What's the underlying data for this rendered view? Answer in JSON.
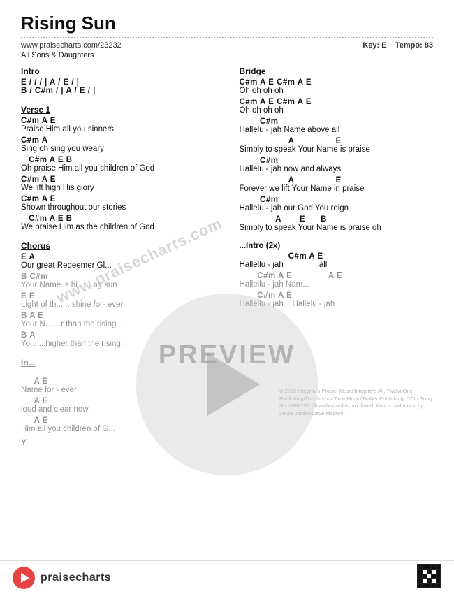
{
  "page": {
    "title": "Rising Sun",
    "url": "www.praisecharts.com/23232",
    "artist": "All Sons & Daughters",
    "key": "Key: E",
    "tempo": "Tempo: 83",
    "watermark_url": "www.praisecharts.com",
    "preview_label": "PREVIEW"
  },
  "sections": {
    "intro": {
      "title": "Intro",
      "lines": [
        {
          "type": "chord",
          "text": "E  /  /  /  |  A  /  E  /  |"
        },
        {
          "type": "chord",
          "text": "B  /  C#m  /  |  A  /  E  /  |"
        }
      ]
    },
    "verse1": {
      "title": "Verse 1",
      "groups": [
        {
          "chord": "C#m              A         E",
          "lyric": "Praise Him all you sinners"
        },
        {
          "chord": "C#m              A",
          "lyric": "Sing oh sing you weary"
        },
        {
          "chord": "   C#m              A         E      B",
          "lyric": "Oh praise Him all you children of God"
        },
        {
          "chord": "C#m              A         E",
          "lyric": "We lift high His glory"
        },
        {
          "chord": "C#m              A         E",
          "lyric": "Shown throughout our stories"
        },
        {
          "chord": "   C#m              A         E      B",
          "lyric": "We praise Him as the children of God"
        }
      ]
    },
    "chorus": {
      "title": "Chorus",
      "groups": [
        {
          "chord": "E                   A",
          "lyric": "Our great Redeemer  Gl..."
        },
        {
          "chord": "B             C#m",
          "lyric": "Your Name is hi...  ...ing sun"
        },
        {
          "chord": "E                              E",
          "lyric": "Light of th...  ...shine for- ever"
        },
        {
          "chord": "B                   A         E",
          "lyric": "Your N...  ...r than the rising..."
        },
        {
          "chord": "B                        A",
          "lyric": "Yo...  ...higher than the rising..."
        }
      ]
    },
    "bridge": {
      "title": "Bridge",
      "groups": [
        {
          "chord": "C#m  A  E  C#m  A  E",
          "lyric": "Oh oh    oh  oh"
        },
        {
          "chord": "C#m  A  E  C#m  A  E",
          "lyric": "Oh oh    oh  oh"
        },
        {
          "chord": "         C#m",
          "lyric": "Hallelu - jah  Name above all"
        },
        {
          "chord": "                   A                  E",
          "lyric": "Simply to speak Your Name is praise"
        },
        {
          "chord": "         C#m",
          "lyric": "Hallelu - jah  now and always"
        },
        {
          "chord": "                   A                  E",
          "lyric": "Forever we lift Your Name in praise"
        },
        {
          "chord": "         C#m",
          "lyric": "Hallelu - jah  our God You reign"
        },
        {
          "chord": "              A         E      B",
          "lyric": "Simply to speak Your Name is praise oh"
        }
      ]
    },
    "intro2x": {
      "title": "Intro (2x)",
      "groups": [
        {
          "chord": "C#m  A  E",
          "lyric": "Hallellu - jah                   all"
        },
        {
          "chord": "C#m  A  E",
          "lyric": "Hallellu - jah  Nam...         A  E"
        },
        {
          "chord": "C#m  A  E",
          "lyric": "Hallellu - jah     Hallelu - jah"
        }
      ]
    }
  },
  "copyright": "© 2012 Integrity's Praise! Music/Integrity's All. TwelveOne Publishing/This Is Your Time Music/Timber Publishing. CCLI Song No. 6364752. Unauthorized is prohibited. Words and music by Leslie Jordan/Dave Mabury.",
  "bottom_bar": {
    "brand": "praisecharts",
    "play_label": "▶"
  }
}
